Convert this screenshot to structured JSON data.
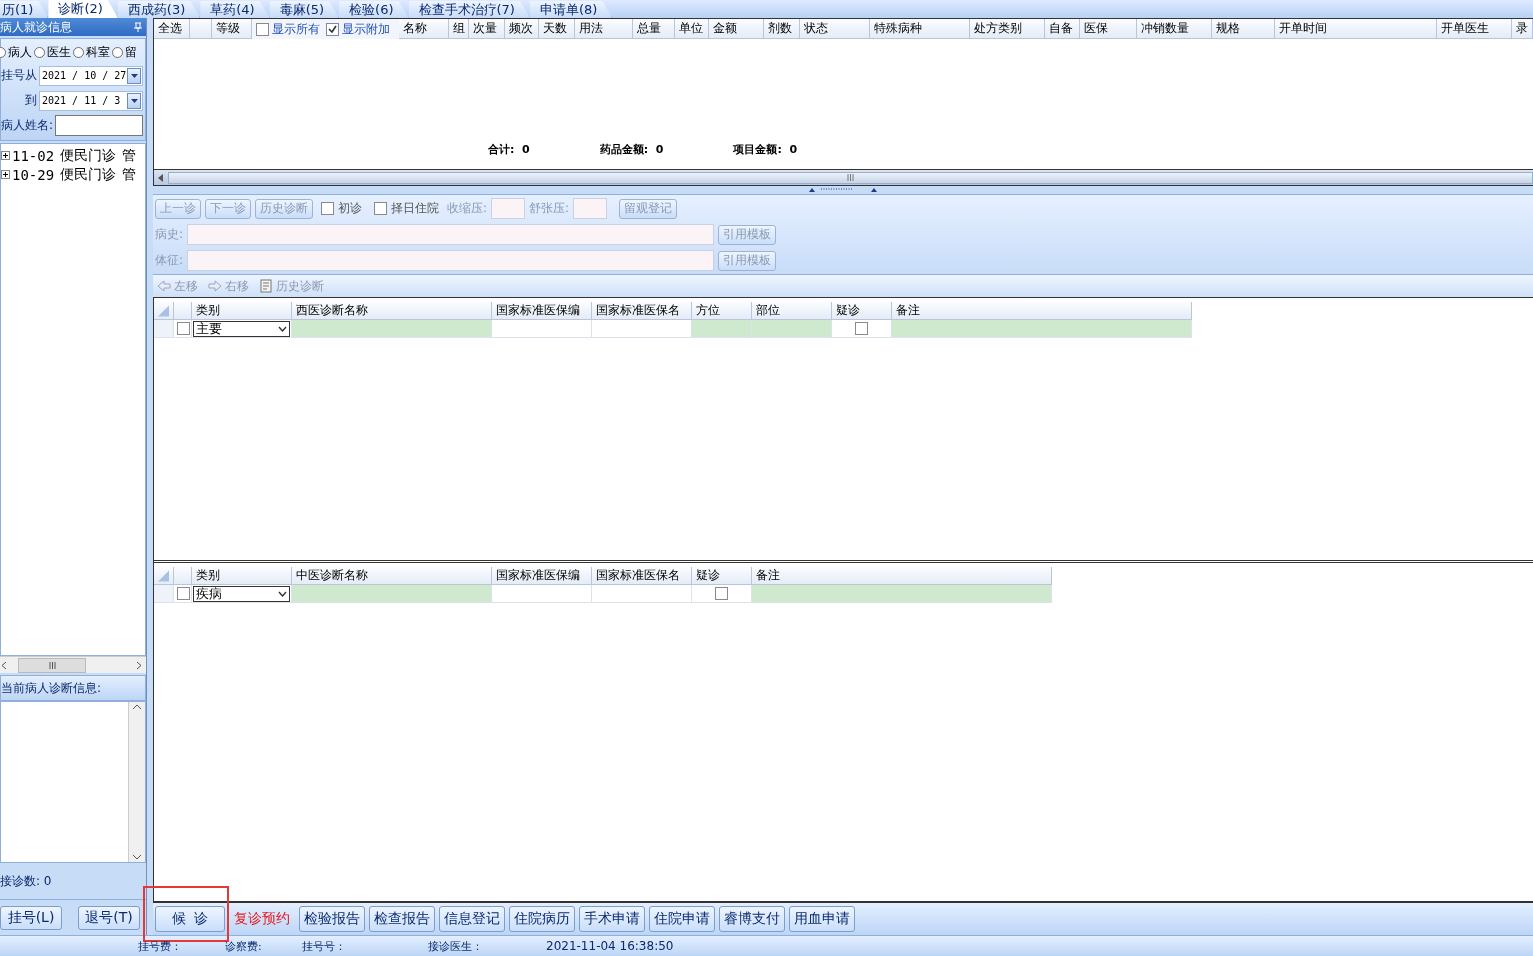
{
  "tabs": [
    {
      "label": "历(1)",
      "selected": false
    },
    {
      "label": "诊断(2)",
      "selected": true
    },
    {
      "label": "西成药(3)",
      "selected": false
    },
    {
      "label": "草药(4)",
      "selected": false
    },
    {
      "label": "毒麻(5)",
      "selected": false
    },
    {
      "label": "检验(6)",
      "selected": false
    },
    {
      "label": "检查手术治疗(7)",
      "selected": false
    },
    {
      "label": "申请单(8)",
      "selected": false
    }
  ],
  "left_panel": {
    "title": "病人就诊信息",
    "filters": [
      {
        "label": "病人",
        "selected": false
      },
      {
        "label": "医生",
        "selected": false
      },
      {
        "label": "科室",
        "selected": false
      },
      {
        "label": "留",
        "selected": false
      }
    ],
    "date_from": {
      "label": "挂号从",
      "value": "2021 / 10 / 27"
    },
    "date_to": {
      "label": "到",
      "value": "2021 / 11 / 3"
    },
    "name_field": {
      "label": "病人姓名:"
    },
    "visits": [
      {
        "date": "11-02",
        "clinic": "便民门诊",
        "doctor": "管"
      },
      {
        "date": "10-29",
        "clinic": "便民门诊",
        "doctor": "管"
      }
    ],
    "diagnosis_title": "当前病人诊断信息:",
    "visit_count": "接诊数: 0",
    "buttons": [
      "挂号(L)",
      "退号(T)"
    ]
  },
  "prescription_table": {
    "columns": [
      {
        "kind": "text",
        "label": "全选"
      },
      {
        "kind": "blank"
      },
      {
        "kind": "text",
        "label": "等级"
      },
      {
        "kind": "check",
        "label": "显示所有",
        "checked": false
      },
      {
        "kind": "check",
        "label": "显示附加",
        "checked": true
      },
      {
        "kind": "text",
        "label": "名称"
      },
      {
        "kind": "text",
        "label": "组"
      },
      {
        "kind": "text",
        "label": "次量"
      },
      {
        "kind": "text",
        "label": "频次"
      },
      {
        "kind": "text",
        "label": "天数"
      },
      {
        "kind": "text",
        "label": "用法"
      },
      {
        "kind": "text",
        "label": "总量"
      },
      {
        "kind": "text",
        "label": "单位"
      },
      {
        "kind": "text",
        "label": "金额"
      },
      {
        "kind": "text",
        "label": "剂数"
      },
      {
        "kind": "text",
        "label": "状态"
      },
      {
        "kind": "text",
        "label": "特殊病种"
      },
      {
        "kind": "text",
        "label": "处方类别"
      },
      {
        "kind": "text",
        "label": "自备"
      },
      {
        "kind": "text",
        "label": "医保"
      },
      {
        "kind": "text",
        "label": "冲销数量"
      },
      {
        "kind": "text",
        "label": "规格"
      },
      {
        "kind": "text",
        "label": "开单时间"
      },
      {
        "kind": "text",
        "label": "开单医生"
      },
      {
        "kind": "text",
        "label": "录"
      }
    ],
    "totals": [
      {
        "label": "合计:",
        "value": "0"
      },
      {
        "label": "药品金额:",
        "value": "0"
      },
      {
        "label": "项目金额:",
        "value": "0"
      }
    ]
  },
  "visit_toolbar": {
    "buttons": [
      {
        "label": "上一诊",
        "disabled": true
      },
      {
        "label": "下一诊",
        "disabled": true
      },
      {
        "label": "历史诊断",
        "disabled": true
      }
    ],
    "checks": [
      {
        "label": "初诊",
        "checked": false
      },
      {
        "label": "择日住院",
        "checked": false
      }
    ],
    "pressure": [
      {
        "label": "收缩压:"
      },
      {
        "label": "舒张压:"
      }
    ],
    "observe_button": {
      "label": "留观登记",
      "disabled": true
    },
    "fields": [
      {
        "label": "病史:",
        "button": "引用模板"
      },
      {
        "label": "体征:",
        "button": "引用模板"
      }
    ]
  },
  "diagnosis_toolbar": [
    {
      "label": "左移",
      "kind": "left"
    },
    {
      "label": "右移",
      "kind": "right"
    },
    {
      "label": "历史诊断",
      "kind": "history"
    }
  ],
  "western_table": {
    "columns": [
      "类别",
      "西医诊断名称",
      "国家标准医保编",
      "国家标准医保名",
      "方位",
      "部位",
      "疑诊",
      "备注"
    ],
    "rows": [
      {
        "checked": false,
        "category": "主要",
        "suspected": false
      }
    ]
  },
  "chinese_table": {
    "columns": [
      "类别",
      "中医诊断名称",
      "国家标准医保编",
      "国家标准医保名",
      "疑诊",
      "备注"
    ],
    "rows": [
      {
        "checked": false,
        "category": "疾病",
        "suspected": false
      }
    ]
  },
  "action_buttons": [
    {
      "label": "候  诊",
      "kind": "normal",
      "highlighted": true
    },
    {
      "label": "复诊预约",
      "kind": "alert",
      "highlighted": false
    },
    {
      "label": "检验报告",
      "kind": "normal",
      "highlighted": false
    },
    {
      "label": "检查报告",
      "kind": "normal",
      "highlighted": false
    },
    {
      "label": "信息登记",
      "kind": "normal",
      "highlighted": false
    },
    {
      "label": "住院病历",
      "kind": "normal",
      "highlighted": false
    },
    {
      "label": "手术申请",
      "kind": "normal",
      "highlighted": false
    },
    {
      "label": "住院申请",
      "kind": "normal",
      "highlighted": false
    },
    {
      "label": "睿博支付",
      "kind": "normal",
      "highlighted": false
    },
    {
      "label": "用血申请",
      "kind": "normal",
      "highlighted": false
    }
  ],
  "status_bar": [
    "挂号费：",
    "诊察费:",
    "挂号号：",
    "接诊医生：",
    "2021-11-04 16:38:50"
  ]
}
